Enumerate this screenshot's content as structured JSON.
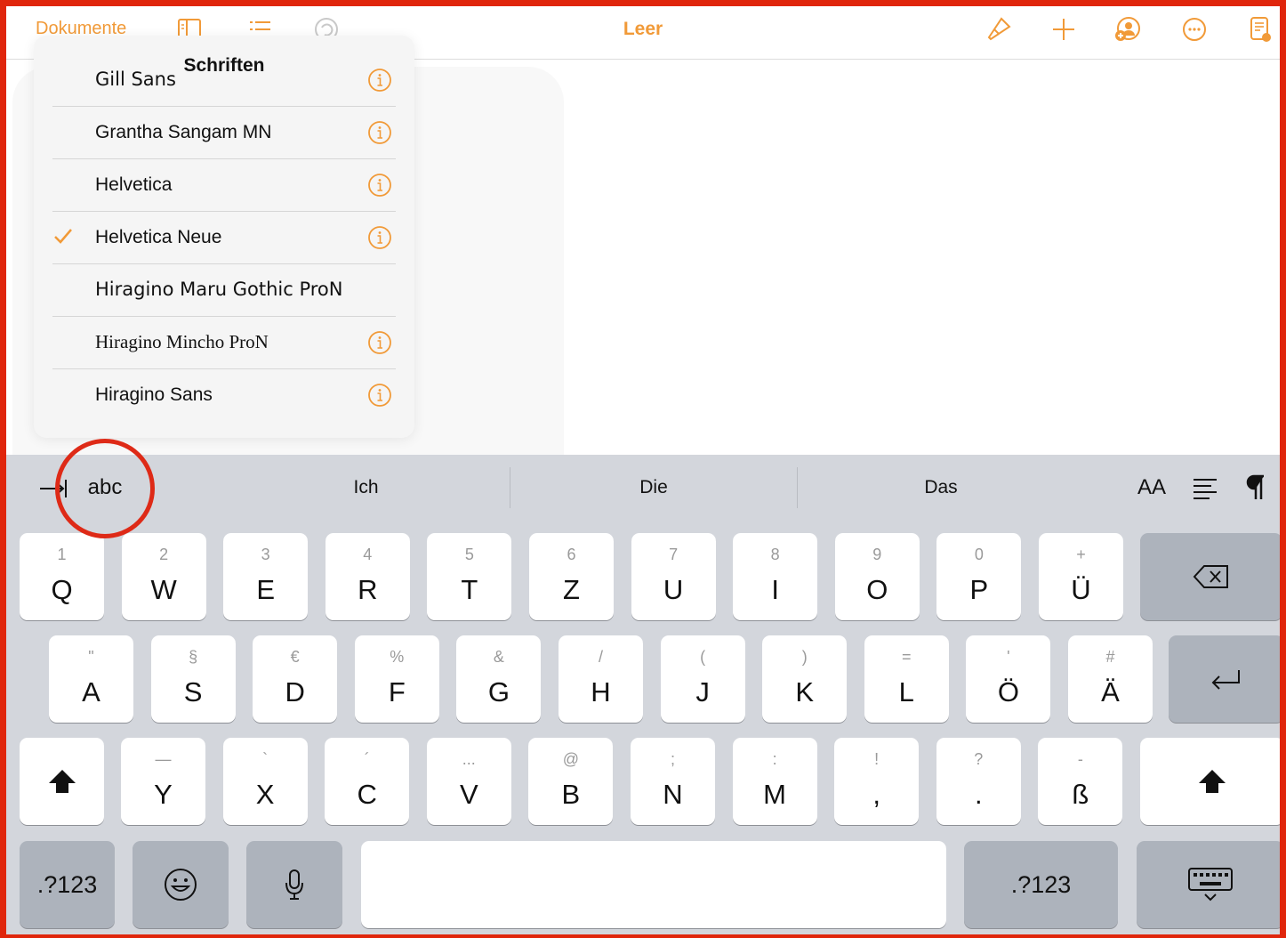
{
  "colors": {
    "accent": "#f19a38",
    "annotation": "#e0260c",
    "keyboard_bg": "#d3d6dc"
  },
  "toolbar": {
    "documents_label": "Dokumente",
    "title": "Leer",
    "left_icons": [
      "sidebar-icon",
      "list-icon",
      "undo-icon"
    ],
    "right_icons": [
      "paintbrush-icon",
      "plus-icon",
      "collaborate-icon",
      "more-icon",
      "document-setup-icon"
    ]
  },
  "font_popover": {
    "title": "Schriften",
    "fonts": [
      {
        "name": "Gill Sans",
        "selected": false,
        "has_info": true
      },
      {
        "name": "Grantha Sangam MN",
        "selected": false,
        "has_info": true
      },
      {
        "name": "Helvetica",
        "selected": false,
        "has_info": true
      },
      {
        "name": "Helvetica Neue",
        "selected": true,
        "has_info": true
      },
      {
        "name": "Hiragino Maru Gothic ProN",
        "selected": false,
        "has_info": false
      },
      {
        "name": "Hiragino Mincho ProN",
        "selected": false,
        "has_info": true
      },
      {
        "name": "Hiragino Sans",
        "selected": false,
        "has_info": true
      }
    ]
  },
  "keyboard": {
    "style_label": "abc",
    "suggestions": [
      "Ich",
      "Die",
      "Das"
    ],
    "font_size_label": "AA",
    "row1": [
      {
        "main": "Q",
        "sec": "1"
      },
      {
        "main": "W",
        "sec": "2"
      },
      {
        "main": "E",
        "sec": "3"
      },
      {
        "main": "R",
        "sec": "4"
      },
      {
        "main": "T",
        "sec": "5"
      },
      {
        "main": "Z",
        "sec": "6"
      },
      {
        "main": "U",
        "sec": "7"
      },
      {
        "main": "I",
        "sec": "8"
      },
      {
        "main": "O",
        "sec": "9"
      },
      {
        "main": "P",
        "sec": "0"
      },
      {
        "main": "Ü",
        "sec": "+"
      }
    ],
    "row2": [
      {
        "main": "A",
        "sec": "\""
      },
      {
        "main": "S",
        "sec": "§"
      },
      {
        "main": "D",
        "sec": "€"
      },
      {
        "main": "F",
        "sec": "%"
      },
      {
        "main": "G",
        "sec": "&"
      },
      {
        "main": "H",
        "sec": "/"
      },
      {
        "main": "J",
        "sec": "("
      },
      {
        "main": "K",
        "sec": ")"
      },
      {
        "main": "L",
        "sec": "="
      },
      {
        "main": "Ö",
        "sec": "'"
      },
      {
        "main": "Ä",
        "sec": "#"
      }
    ],
    "row3": [
      {
        "main": "Y",
        "sec": "—"
      },
      {
        "main": "X",
        "sec": "`"
      },
      {
        "main": "C",
        "sec": "´"
      },
      {
        "main": "V",
        "sec": "..."
      },
      {
        "main": "B",
        "sec": "@"
      },
      {
        "main": "N",
        "sec": ";"
      },
      {
        "main": "M",
        "sec": ":"
      },
      {
        "main": ",",
        "sec": "!"
      },
      {
        "main": ".",
        "sec": "?"
      },
      {
        "main": "ß",
        "sec": "-"
      }
    ],
    "numbers_label": ".?123"
  }
}
